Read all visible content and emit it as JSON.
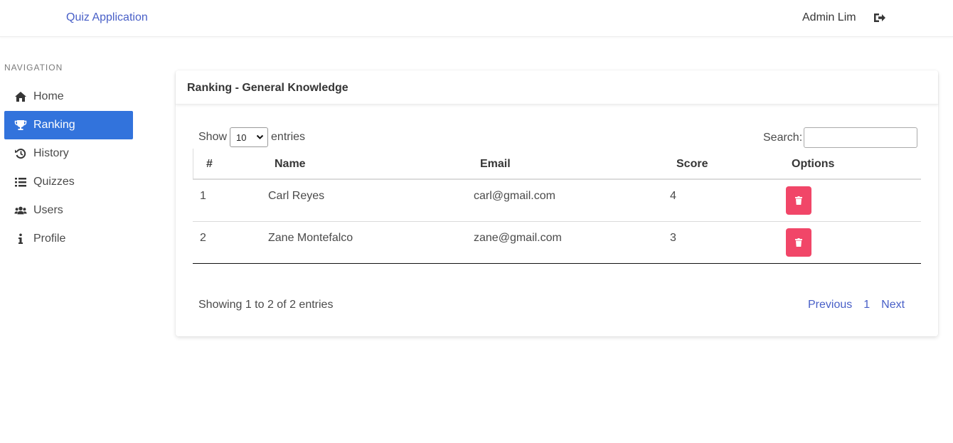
{
  "header": {
    "brand": "Quiz Application",
    "user_name": "Admin Lim",
    "logout_icon": "sign-out-icon"
  },
  "sidebar": {
    "label": "NAVIGATION",
    "active_color": "#3273dc",
    "items": [
      {
        "label": "Home",
        "icon": "home-icon"
      },
      {
        "label": "Ranking",
        "icon": "trophy-icon",
        "active": true
      },
      {
        "label": "History",
        "icon": "history-icon"
      },
      {
        "label": "Quizzes",
        "icon": "list-icon"
      },
      {
        "label": "Users",
        "icon": "users-icon"
      },
      {
        "label": "Profile",
        "icon": "info-icon"
      }
    ]
  },
  "card": {
    "title": "Ranking - General Knowledge",
    "length": {
      "prefix": "Show",
      "value": "10",
      "suffix": "entries"
    },
    "search": {
      "label": "Search:",
      "value": ""
    },
    "columns": [
      "#",
      "Name",
      "Email",
      "Score",
      "Options"
    ],
    "rows": [
      {
        "rank": "1",
        "name": "Carl Reyes",
        "email": "carl@gmail.com",
        "score": "4"
      },
      {
        "rank": "2",
        "name": "Zane Montefalco",
        "email": "zane@gmail.com",
        "score": "3"
      }
    ],
    "delete_color": "#f14668",
    "info": "Showing 1 to 2 of 2 entries",
    "pagination": {
      "previous": "Previous",
      "current": "1",
      "next": "Next"
    }
  }
}
